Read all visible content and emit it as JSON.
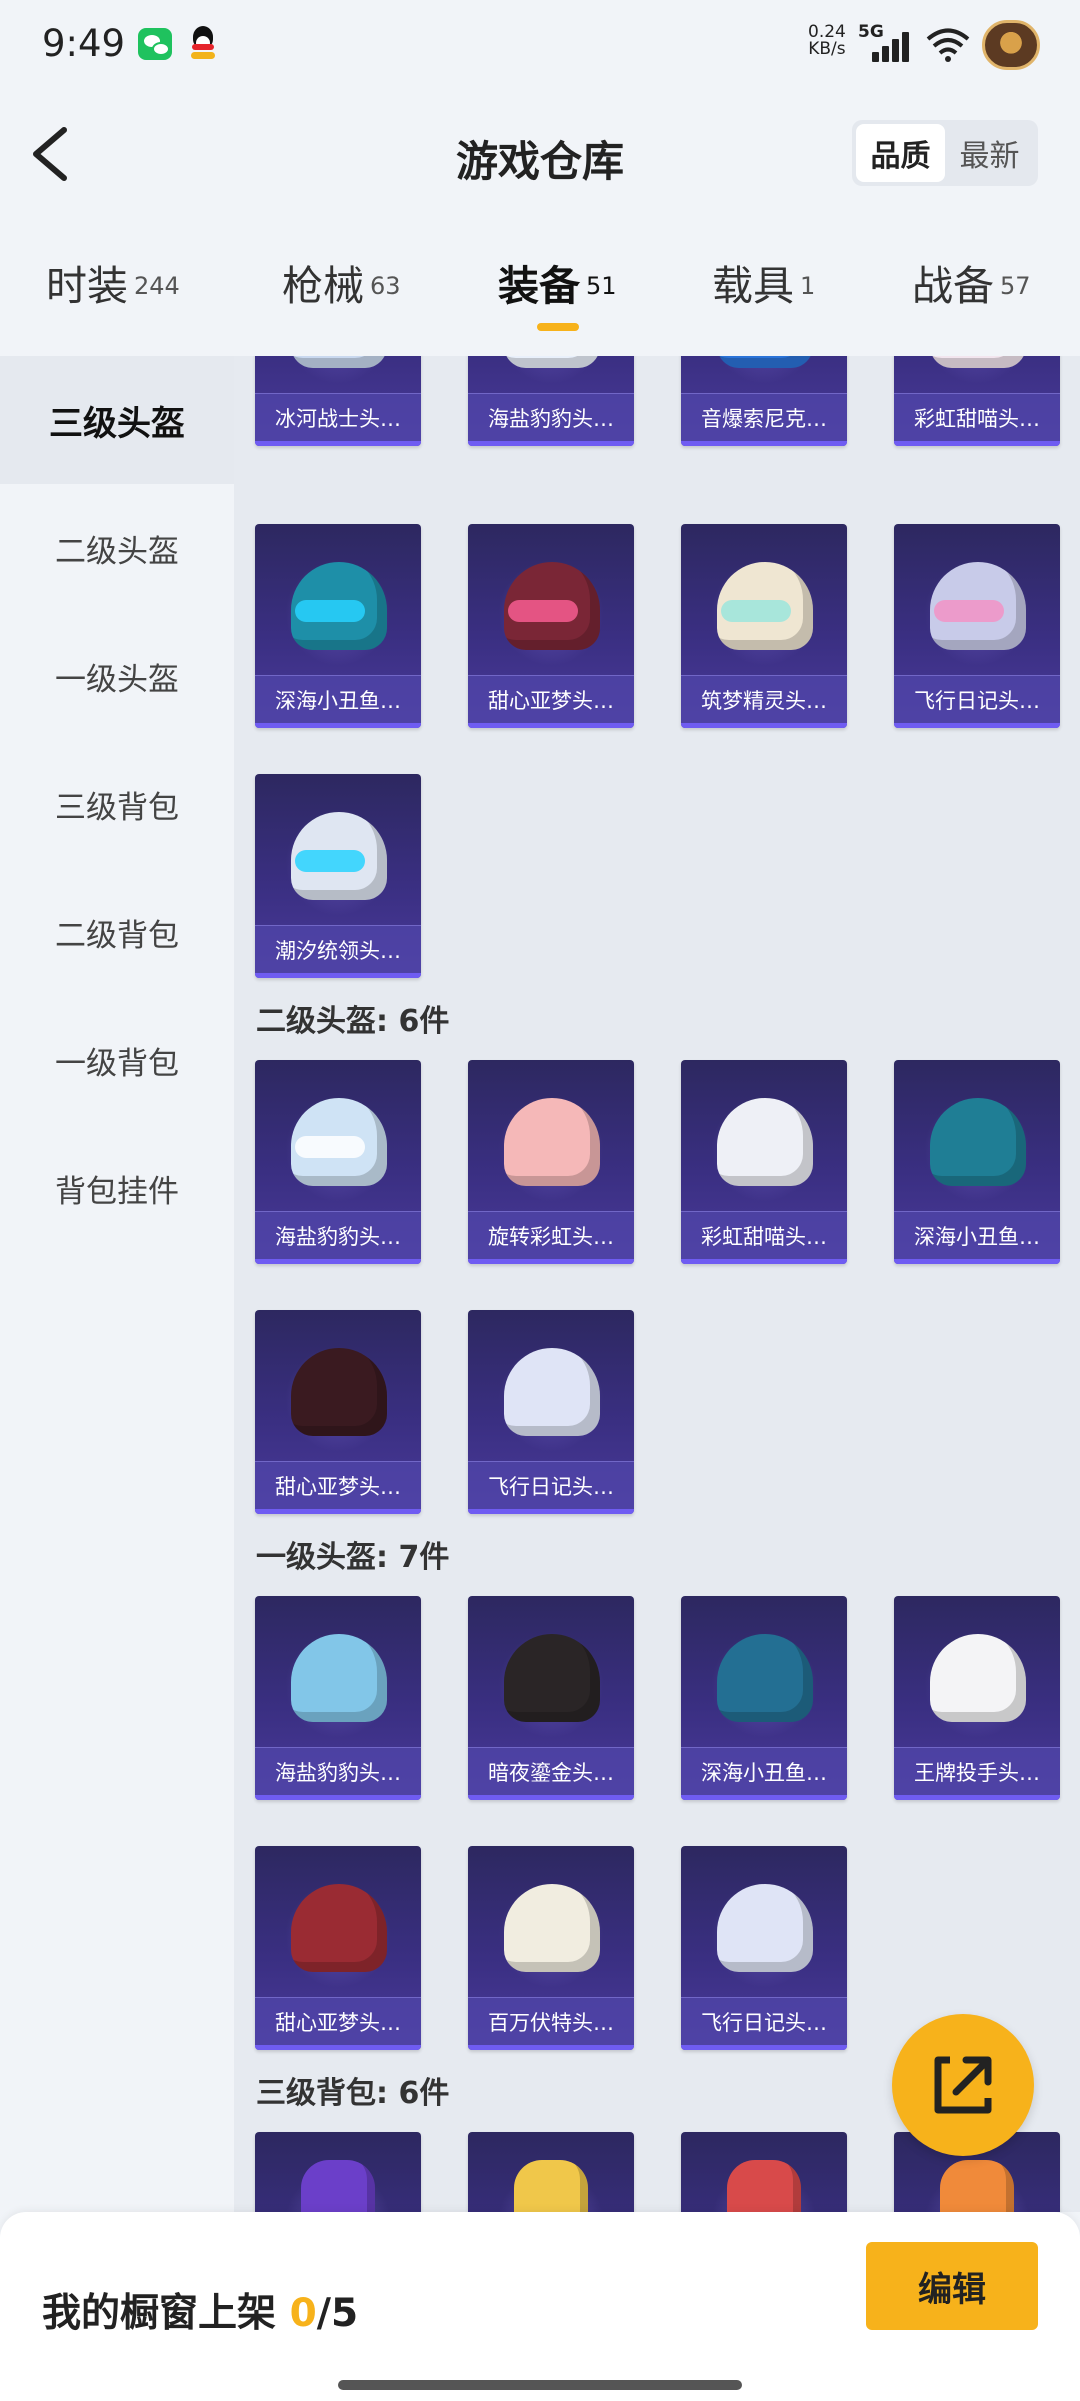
{
  "status_bar": {
    "time": "9:49",
    "speed_value": "0.24",
    "speed_unit": "KB/s",
    "network": "5G",
    "icons": [
      "wechat-icon",
      "qq-icon",
      "signal-icon",
      "wifi-icon",
      "avatar"
    ]
  },
  "header": {
    "title": "游戏仓库",
    "back_icon": "chevron-left-icon",
    "sort_options": [
      "品质",
      "最新"
    ],
    "sort_selected": "品质"
  },
  "tabs": [
    {
      "label": "时装",
      "count": "244"
    },
    {
      "label": "枪械",
      "count": "63"
    },
    {
      "label": "装备",
      "count": "51",
      "active": true
    },
    {
      "label": "载具",
      "count": "1"
    },
    {
      "label": "战备",
      "count": "57"
    }
  ],
  "sidebar": {
    "items": [
      "三级头盔",
      "二级头盔",
      "一级头盔",
      "三级背包",
      "二级背包",
      "一级背包",
      "背包挂件"
    ],
    "active": "三级头盔"
  },
  "sections": {
    "level3_helmet": {
      "items": [
        "冰河战士头…",
        "海盐豹豹头…",
        "音爆索尼克…",
        "彩虹甜喵头…",
        "深海小丑鱼…",
        "甜心亚梦头…",
        "筑梦精灵头…",
        "飞行日记头…",
        "潮汐统领头…"
      ]
    },
    "level2_helmet": {
      "title": "二级头盔: 6件",
      "items": [
        "海盐豹豹头…",
        "旋转彩虹头…",
        "彩虹甜喵头…",
        "深海小丑鱼…",
        "甜心亚梦头…",
        "飞行日记头…"
      ]
    },
    "level1_helmet": {
      "title": "一级头盔: 7件",
      "items": [
        "海盐豹豹头…",
        "暗夜鎏金头…",
        "深海小丑鱼…",
        "王牌投手头…",
        "甜心亚梦头…",
        "百万伏特头…",
        "飞行日记头…"
      ]
    },
    "level3_backpack": {
      "title": "三级背包: 6件"
    }
  },
  "bottom_bar": {
    "label": "我的橱窗上架",
    "count": "0",
    "total": "/5",
    "edit_button": "编辑"
  },
  "fab_icon": "share-icon"
}
